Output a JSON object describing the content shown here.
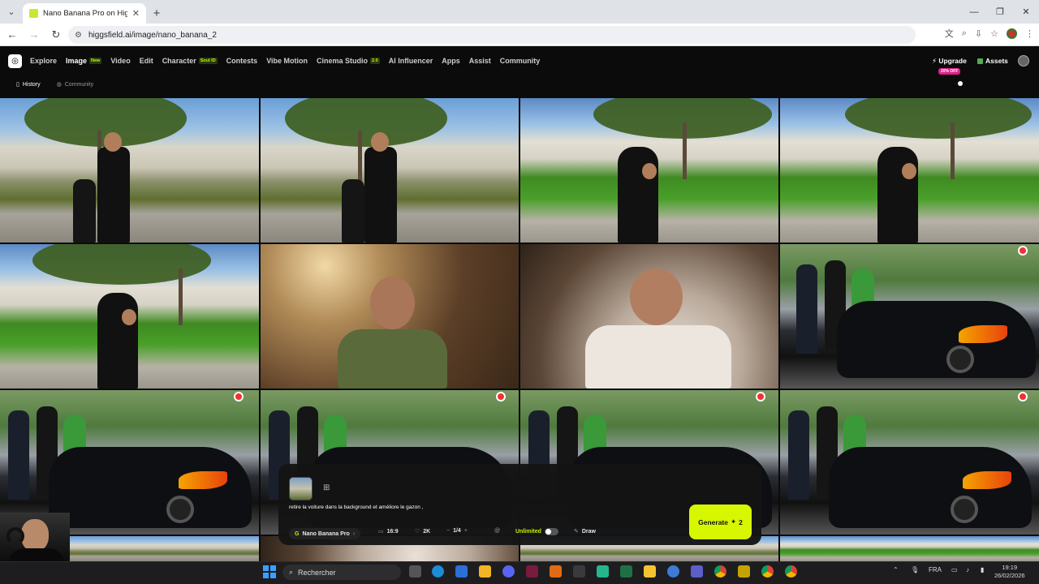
{
  "browser": {
    "tab_title": "Nano Banana Pro on Higgsfield",
    "url": "higgsfield.ai/image/nano_banana_2",
    "new_tab": "+",
    "min": "—",
    "max": "❐",
    "close": "✕"
  },
  "nav": {
    "items": [
      {
        "label": "Explore"
      },
      {
        "label": "Image",
        "badge": "New",
        "active": true
      },
      {
        "label": "Video"
      },
      {
        "label": "Edit"
      },
      {
        "label": "Character",
        "badge": "Soul ID"
      },
      {
        "label": "Contests"
      },
      {
        "label": "Vibe Motion"
      },
      {
        "label": "Cinema Studio",
        "badge": "2.0"
      },
      {
        "label": "AI Influencer"
      },
      {
        "label": "Apps"
      },
      {
        "label": "Assist"
      },
      {
        "label": "Community"
      }
    ],
    "upgrade": "Upgrade",
    "upgrade_badge": "20% OFF",
    "assets": "Assets"
  },
  "subnav": {
    "history": "History",
    "community": "Community"
  },
  "prompt_panel": {
    "prompt_text": "retire la voiture dans la background et améliore le gazon ,",
    "model": "Nano Banana Pro",
    "aspect_ratio": "16:9",
    "resolution": "2K",
    "count": "1/4",
    "unlimited": "Unlimited",
    "draw": "Draw",
    "generate": "Generate",
    "generate_cost": "2"
  },
  "taskbar": {
    "search_placeholder": "Rechercher",
    "lang": "FRA",
    "time": "19:19",
    "date": "26/02/2026"
  },
  "colors": {
    "accent": "#d6f700",
    "background": "#0b0b0b"
  }
}
